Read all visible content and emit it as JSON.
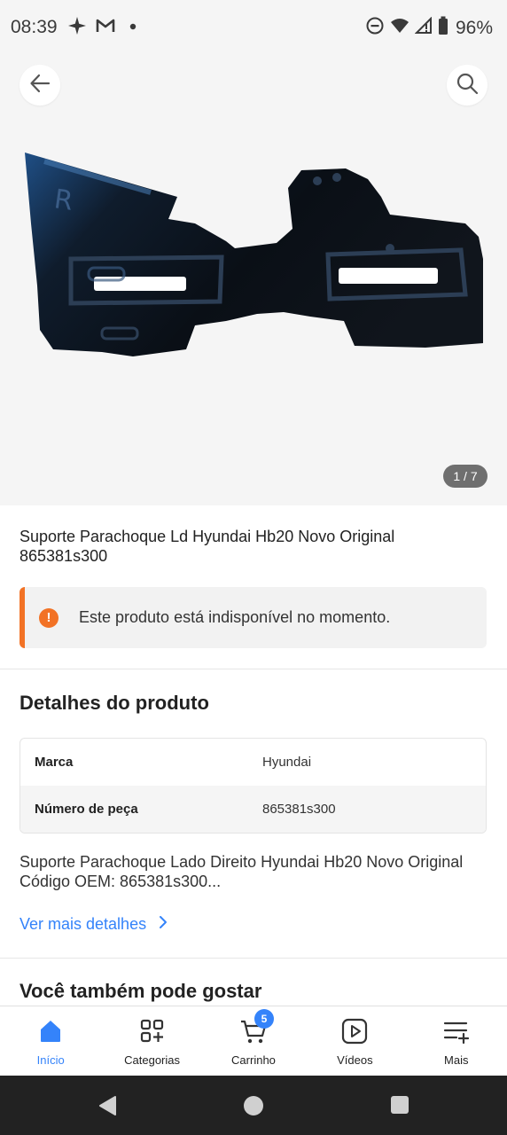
{
  "status_bar": {
    "time": "08:39",
    "battery": "96%",
    "left_icons": [
      "sparkle-icon",
      "gmail-icon",
      "dot-icon"
    ],
    "right_icons": [
      "dnd-icon",
      "wifi-icon",
      "signal-icon",
      "battery-icon"
    ]
  },
  "gallery": {
    "counter": "1 / 7",
    "image_mark": "R"
  },
  "product": {
    "title": "Suporte Parachoque Ld Hyundai Hb20 Novo Original 865381s300",
    "notice": "Este produto está indisponível no momento."
  },
  "details": {
    "heading": "Detalhes do produto",
    "specs": [
      {
        "key": "Marca",
        "value": "Hyundai"
      },
      {
        "key": "Número de peça",
        "value": "865381s300"
      }
    ],
    "description": "Suporte Parachoque Lado Direito Hyundai Hb20 Novo Original Código OEM: 865381s300...",
    "more_link": "Ver mais detalhes"
  },
  "recommend": {
    "heading": "Você também pode gostar"
  },
  "bottom_nav": {
    "items": [
      {
        "label": "Início",
        "icon": "home-icon",
        "active": true
      },
      {
        "label": "Categorias",
        "icon": "categories-icon",
        "active": false
      },
      {
        "label": "Carrinho",
        "icon": "cart-icon",
        "active": false
      },
      {
        "label": "Vídeos",
        "icon": "video-icon",
        "active": false
      },
      {
        "label": "Mais",
        "icon": "menu-plus-icon",
        "active": false
      }
    ],
    "cart_count": "5"
  },
  "colors": {
    "accent": "#3483fa",
    "warning": "#f27225"
  }
}
